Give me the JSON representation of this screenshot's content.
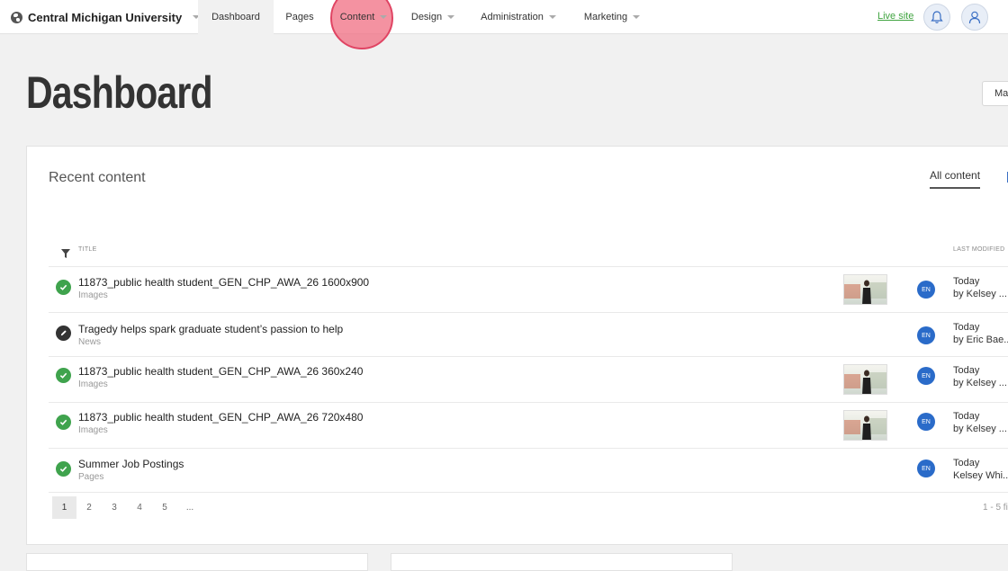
{
  "nav": {
    "site_name": "Central Michigan University",
    "items": [
      "Dashboard",
      "Pages",
      "Content",
      "Design",
      "Administration",
      "Marketing"
    ],
    "live_site": "Live site"
  },
  "header": {
    "title": "Dashboard",
    "corner_button": "Ma"
  },
  "recent": {
    "title": "Recent content",
    "tab_all": "All content",
    "col_title": "TITLE",
    "col_modified": "LAST MODIFIED",
    "rows": [
      {
        "status": "published",
        "title": "11873_public health student_GEN_CHP_AWA_26 1600x900",
        "type": "Images",
        "lang": "EN",
        "date": "Today",
        "by": "by Kelsey ..."
      },
      {
        "status": "draft",
        "title": "Tragedy helps spark graduate student’s passion to help",
        "type": "News",
        "lang": "EN",
        "date": "Today",
        "by": "by Eric Bae..."
      },
      {
        "status": "published",
        "title": "11873_public health student_GEN_CHP_AWA_26 360x240",
        "type": "Images",
        "lang": "EN",
        "date": "Today",
        "by": "by Kelsey ..."
      },
      {
        "status": "published",
        "title": "11873_public health student_GEN_CHP_AWA_26 720x480",
        "type": "Images",
        "lang": "EN",
        "date": "Today",
        "by": "by Kelsey ..."
      },
      {
        "status": "published",
        "title": "Summer Job Postings",
        "type": "Pages",
        "lang": "EN",
        "date": "Today",
        "by": "Kelsey Whi..."
      }
    ],
    "pages": [
      "1",
      "2",
      "3",
      "4",
      "5",
      "..."
    ],
    "range": "1 - 5 fi"
  },
  "colors": {
    "accent_green": "#3fa34d",
    "lang_blue": "#2a6bc9",
    "click_marker": "#e04463"
  },
  "icons": {
    "site": "globe-icon",
    "notifications": "bell-icon",
    "account": "user-icon",
    "filter": "filter-icon",
    "published": "check-circle-icon",
    "draft": "pencil-circle-icon"
  }
}
